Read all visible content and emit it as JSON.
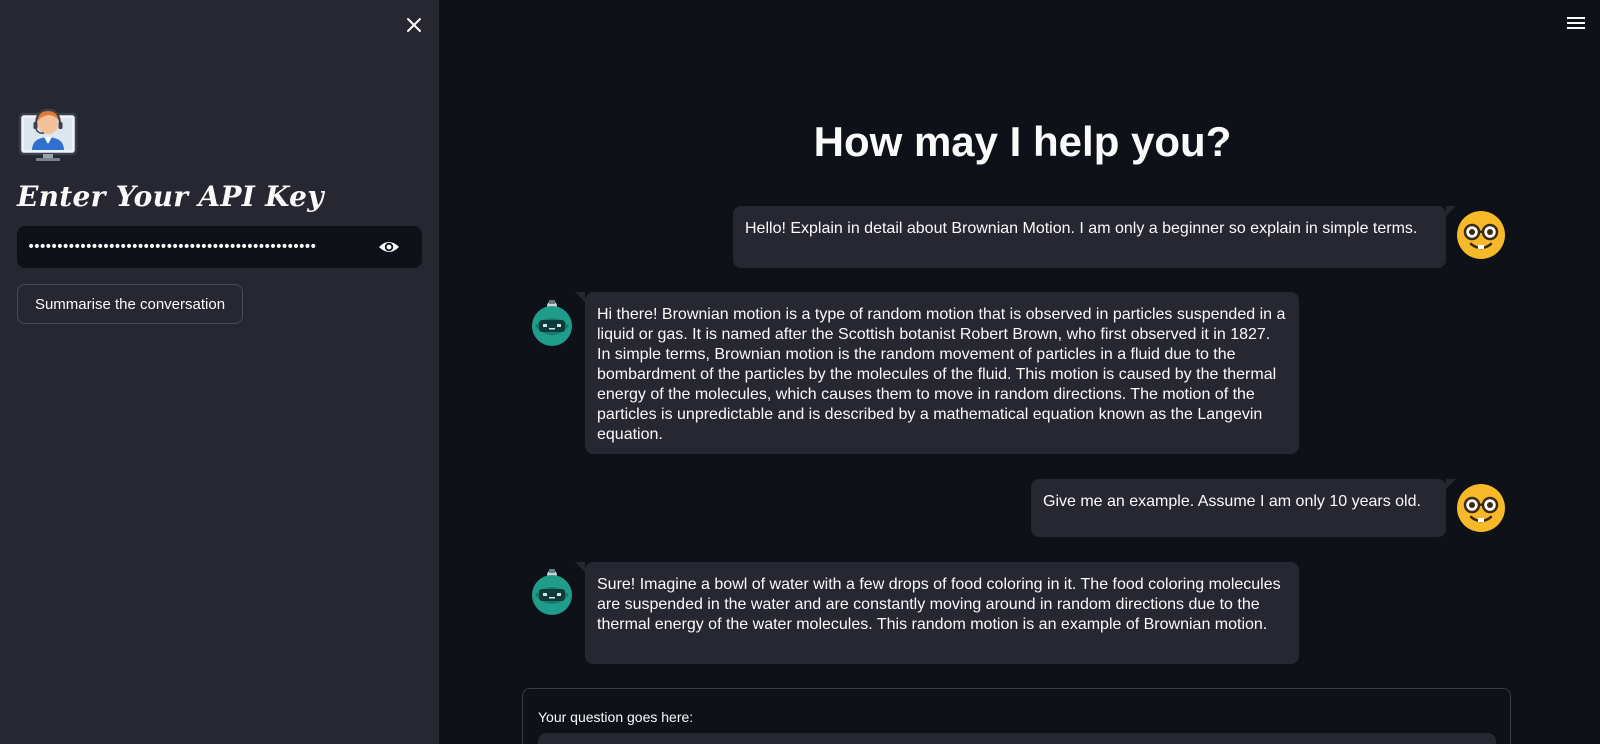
{
  "sidebar": {
    "heading": "Enter Your API Key",
    "api_key_masked": "••••••••••••••••••••••••••••••••••••••••••••••••••",
    "summarise_button": "Summarise the conversation",
    "icons": {
      "close": "close-icon",
      "logo": "support-agent-computer-icon",
      "eye": "eye-icon"
    }
  },
  "header": {
    "menu_icon": "hamburger-menu-icon"
  },
  "main": {
    "title": "How may I help you?",
    "messages": [
      {
        "role": "user",
        "text": "Hello! Explain in detail about Brownian Motion. I am only a beginner so explain in simple terms.",
        "avatar": "nerd-face-icon"
      },
      {
        "role": "bot",
        "text": "Hi there! Brownian motion is a type of random motion that is observed in particles suspended in a liquid or gas. It is named after the Scottish botanist Robert Brown, who first observed it in 1827. In simple terms, Brownian motion is the random movement of particles in a fluid due to the bombardment of the particles by the molecules of the fluid. This motion is caused by the thermal energy of the molecules, which causes them to move in random directions. The motion of the particles is unpredictable and is described by a mathematical equation known as the Langevin equation.",
        "avatar": "robot-icon"
      },
      {
        "role": "user",
        "text": "Give me an example. Assume I am only 10 years old.",
        "avatar": "nerd-face-icon"
      },
      {
        "role": "bot",
        "text": "Sure! Imagine a bowl of water with a few drops of food coloring in it. The food coloring molecules are suspended in the water and are constantly moving around in random directions due to the thermal energy of the water molecules. This random motion is an example of Brownian motion.",
        "avatar": "robot-icon"
      }
    ],
    "question_label": "Your question goes here:",
    "question_value": ""
  },
  "colors": {
    "background": "#0e1117",
    "sidebar": "#262730",
    "bubble": "#262730",
    "text": "#fafafa"
  }
}
